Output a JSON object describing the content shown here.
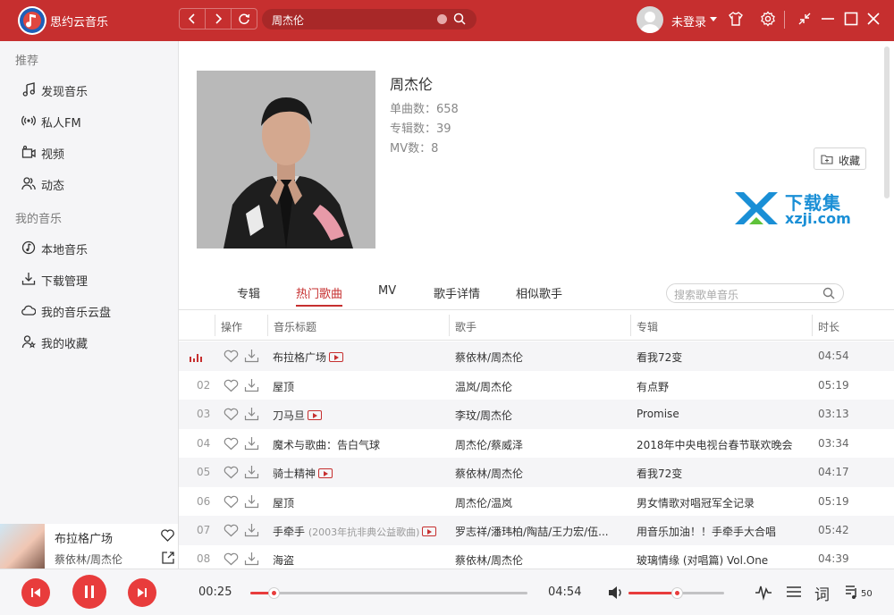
{
  "app": {
    "title": "思约云音乐"
  },
  "header": {
    "search_value": "周杰伦",
    "login_label": "未登录"
  },
  "sidebar": {
    "section_recommend": "推荐",
    "recommend_items": [
      {
        "label": "发现音乐",
        "icon": "music-note-icon"
      },
      {
        "label": "私人FM",
        "icon": "radio-icon"
      },
      {
        "label": "视频",
        "icon": "video-icon"
      },
      {
        "label": "动态",
        "icon": "friends-icon"
      }
    ],
    "section_mine": "我的音乐",
    "mine_items": [
      {
        "label": "本地音乐",
        "icon": "local-music-icon"
      },
      {
        "label": "下载管理",
        "icon": "download-icon"
      },
      {
        "label": "我的音乐云盘",
        "icon": "cloud-icon"
      },
      {
        "label": "我的收藏",
        "icon": "collection-icon"
      }
    ]
  },
  "now_playing": {
    "title": "布拉格广场",
    "artist": "蔡依林/周杰伦"
  },
  "artist": {
    "name": "周杰伦",
    "songs_stat": "单曲数：658",
    "albums_stat": "专辑数：39",
    "mv_stat": "MV数：8",
    "favorite_label": "收藏"
  },
  "watermark": {
    "title": "下载集",
    "url": "xzji.com"
  },
  "tabs": [
    {
      "label": "专辑",
      "active": false
    },
    {
      "label": "热门歌曲",
      "active": true
    },
    {
      "label": "MV",
      "active": false
    },
    {
      "label": "歌手详情",
      "active": false
    },
    {
      "label": "相似歌手",
      "active": false
    }
  ],
  "inner_search_placeholder": "搜索歌单音乐",
  "table": {
    "headers": {
      "ops": "操作",
      "title": "音乐标题",
      "artist": "歌手",
      "album": "专辑",
      "duration": "时长"
    },
    "rows": [
      {
        "index": "",
        "playing": true,
        "title": "布拉格广场",
        "note": "",
        "mv": true,
        "artist": "蔡依林/周杰伦",
        "album": "看我72变",
        "duration": "04:54"
      },
      {
        "index": "02",
        "playing": false,
        "title": "屋顶",
        "note": "",
        "mv": false,
        "artist": "温岚/周杰伦",
        "album": "有点野",
        "duration": "05:19"
      },
      {
        "index": "03",
        "playing": false,
        "title": "刀马旦",
        "note": "",
        "mv": true,
        "artist": "李玟/周杰伦",
        "album": "Promise",
        "duration": "03:13"
      },
      {
        "index": "04",
        "playing": false,
        "title": "魔术与歌曲：告白气球",
        "note": "",
        "mv": false,
        "artist": "周杰伦/蔡威泽",
        "album": "2018年中央电视台春节联欢晚会",
        "duration": "03:34"
      },
      {
        "index": "05",
        "playing": false,
        "title": "骑士精神",
        "note": "",
        "mv": true,
        "artist": "蔡依林/周杰伦",
        "album": "看我72变",
        "duration": "04:17"
      },
      {
        "index": "06",
        "playing": false,
        "title": "屋顶",
        "note": "",
        "mv": false,
        "artist": "周杰伦/温岚",
        "album": "男女情歌对唱冠军全记录",
        "duration": "05:19"
      },
      {
        "index": "07",
        "playing": false,
        "title": "手牵手",
        "note": "(2003年抗非典公益歌曲)",
        "mv": true,
        "artist": "罗志祥/潘玮柏/陶喆/王力宏/伍...",
        "album": "用音乐加油！！手牵手大合唱",
        "duration": "05:42"
      },
      {
        "index": "08",
        "playing": false,
        "title": "海盗",
        "note": "",
        "mv": false,
        "artist": "蔡依林/周杰伦",
        "album": "玻璃情缘 (对唱篇) Vol.One",
        "duration": "04:39"
      }
    ]
  },
  "player": {
    "current_time": "00:25",
    "total_time": "04:54",
    "progress_fraction": 0.085,
    "volume_fraction": 0.5,
    "lyrics_label": "词",
    "playlist_count": "50"
  },
  "colors": {
    "brand": "#c62f2f",
    "accent": "#e83c3c"
  }
}
